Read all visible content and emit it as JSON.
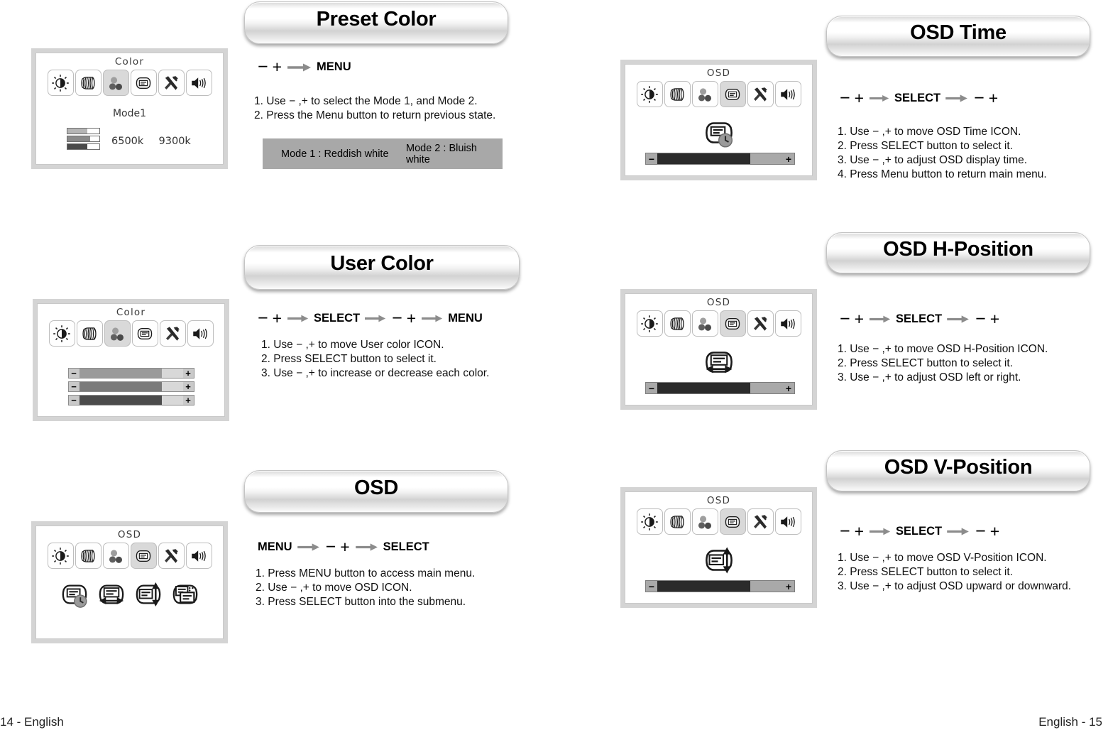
{
  "page": {
    "footer_left": "14 - English",
    "footer_right": "English - 15"
  },
  "icons": {
    "brightness": "brightness-contrast-icon",
    "geometry": "geometry-icon",
    "color": "color-icon",
    "osd": "osd-icon",
    "tools": "tools-icon",
    "audio": "audio-icon",
    "osd_time": "osd-time-icon",
    "osd_hpos": "osd-h-position-icon",
    "osd_vpos": "osd-v-position-icon",
    "osd_reset": "osd-reset-icon",
    "arrow": "right-arrow-icon",
    "minus": "minus-icon",
    "plus": "plus-icon"
  },
  "sections": [
    {
      "id": "preset-color",
      "title": "Preset Color",
      "sequence": [
        "−",
        "+",
        "ARROW",
        "MENU"
      ],
      "steps": [
        "1. Use − ,+ to select the Mode 1, and Mode 2.",
        "2. Press the Menu button to return previous state."
      ],
      "note": {
        "mode_a": "Mode 1 : Reddish white",
        "mode_b": "Mode 2 : Bluish white"
      },
      "panel": {
        "menu_title": "Color",
        "selected_icon_index": 2,
        "mode_label": "Mode1",
        "kelvin_a": "6500k",
        "kelvin_b": "9300k",
        "mini_bars": [
          {
            "fill_pct": 62,
            "color": "#b5b5b5"
          },
          {
            "fill_pct": 72,
            "color": "#8a8a8a"
          },
          {
            "fill_pct": 62,
            "color": "#4a4a4a"
          }
        ]
      }
    },
    {
      "id": "user-color",
      "title": "User Color",
      "sequence": [
        "−",
        "+",
        "ARROW",
        "SELECT",
        "ARROW",
        "−",
        "+",
        "ARROW",
        "MENU"
      ],
      "steps": [
        "1. Use − ,+ to move User color ICON.",
        "2. Press SELECT button to select it.",
        "3. Use − ,+ to increase or decrease each color."
      ],
      "panel": {
        "menu_title": "Color",
        "selected_icon_index": 2,
        "sliders": [
          {
            "fill_pct": 80,
            "color": "#9a9a9a",
            "minus": "−",
            "plus": "+"
          },
          {
            "fill_pct": 80,
            "color": "#7a7a7a",
            "minus": "−",
            "plus": "+"
          },
          {
            "fill_pct": 80,
            "color": "#4b4b4b",
            "minus": "−",
            "plus": "+"
          }
        ]
      }
    },
    {
      "id": "osd",
      "title": "OSD",
      "sequence": [
        "MENU",
        "ARROW",
        "−",
        "+",
        "ARROW",
        "SELECT"
      ],
      "steps": [
        "1. Press MENU button to access main menu.",
        "2. Use − ,+ to move OSD ICON.",
        "3. Press SELECT button into the submenu."
      ],
      "panel": {
        "menu_title": "OSD",
        "selected_icon_index": 3,
        "sub_icons": [
          "osd-time-icon",
          "osd-h-position-icon",
          "osd-v-position-icon",
          "osd-reset-icon"
        ]
      }
    },
    {
      "id": "osd-time",
      "title": "OSD Time",
      "sequence": [
        "−",
        "+",
        "ARROW",
        "SELECT",
        "ARROW",
        "−",
        "+"
      ],
      "steps": [
        "1. Use − ,+ to move OSD Time ICON.",
        "2. Press SELECT button to select it.",
        "3. Use − ,+ to adjust OSD display time.",
        "4. Press Menu button to return main menu."
      ],
      "panel": {
        "menu_title": "OSD",
        "selected_icon_index": 3,
        "sub_icon": "osd-time-icon",
        "bar": {
          "fill_pct": 74,
          "minus": "−",
          "plus": "+"
        }
      }
    },
    {
      "id": "osd-h-position",
      "title": "OSD H-Position",
      "sequence": [
        "−",
        "+",
        "ARROW",
        "SELECT",
        "ARROW",
        "−",
        "+"
      ],
      "steps": [
        "1. Use − ,+ to move OSD H-Position ICON.",
        "2. Press SELECT button to select it.",
        "3. Use − ,+ to adjust OSD left or right."
      ],
      "panel": {
        "menu_title": "OSD",
        "selected_icon_index": 3,
        "sub_icon": "osd-h-position-icon",
        "bar": {
          "fill_pct": 74,
          "minus": "−",
          "plus": "+"
        }
      }
    },
    {
      "id": "osd-v-position",
      "title": "OSD V-Position",
      "sequence": [
        "−",
        "+",
        "ARROW",
        "SELECT",
        "ARROW",
        "−",
        "+"
      ],
      "steps": [
        "1. Use − ,+ to move OSD V-Position ICON.",
        "2. Press SELECT button to select it.",
        "3. Use − ,+ to adjust OSD upward or downward."
      ],
      "panel": {
        "menu_title": "OSD",
        "selected_icon_index": 3,
        "sub_icon": "osd-v-position-icon",
        "bar": {
          "fill_pct": 74,
          "minus": "−",
          "plus": "+"
        }
      }
    }
  ]
}
